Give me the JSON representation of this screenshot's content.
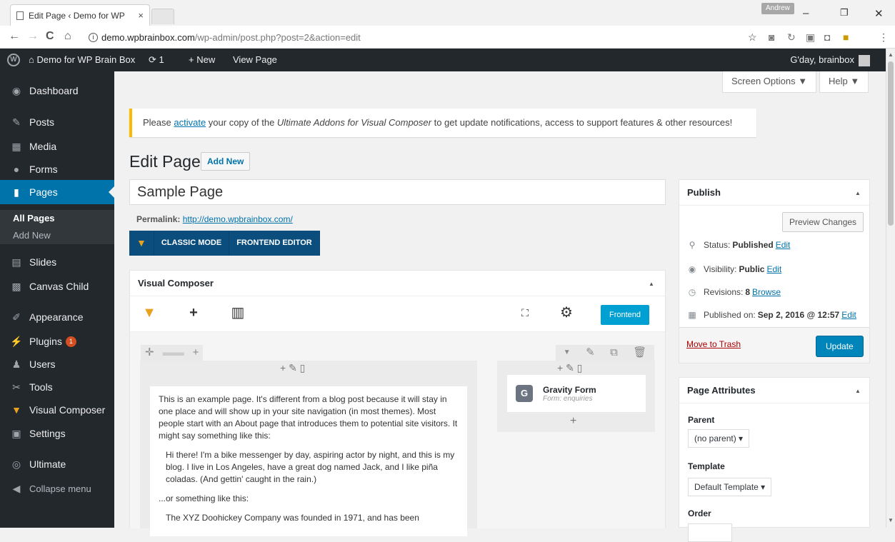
{
  "browser": {
    "tab_title": "Edit Page ‹ Demo for WP",
    "tab_close": "×",
    "profile": "Andrew",
    "win_min": "–",
    "win_max": "❐",
    "win_close": "✕",
    "back": "←",
    "forward": "→",
    "reload": "C",
    "home": "⌂",
    "url_host": "demo.wpbrainbox.com",
    "url_path": "/wp-admin/post.php?post=2&action=edit",
    "bookmark": "☆",
    "menu": "⋮"
  },
  "adminbar": {
    "site_name": "Demo for WP Brain Box",
    "updates_count": "1",
    "new_label": "New",
    "view_page": "View Page",
    "greeting": "G'day, brainbox"
  },
  "sidebar": {
    "items": [
      {
        "label": "Dashboard",
        "icon": "dashboard-icon"
      },
      {
        "label": "Posts",
        "icon": "pin-icon"
      },
      {
        "label": "Media",
        "icon": "media-icon"
      },
      {
        "label": "Forms",
        "icon": "forms-icon"
      },
      {
        "label": "Pages",
        "icon": "pages-icon"
      },
      {
        "label": "Slides",
        "icon": "slides-icon"
      },
      {
        "label": "Canvas Child",
        "icon": "canvas-icon"
      },
      {
        "label": "Appearance",
        "icon": "brush-icon"
      },
      {
        "label": "Plugins",
        "icon": "plugin-icon",
        "badge": "1"
      },
      {
        "label": "Users",
        "icon": "users-icon"
      },
      {
        "label": "Tools",
        "icon": "wrench-icon"
      },
      {
        "label": "Visual Composer",
        "icon": "vc-icon"
      },
      {
        "label": "Settings",
        "icon": "settings-icon"
      },
      {
        "label": "Ultimate",
        "icon": "ultimate-icon"
      },
      {
        "label": "Collapse menu",
        "icon": "collapse-icon"
      }
    ],
    "submenu": [
      "All Pages",
      "Add New"
    ]
  },
  "screen_options": "Screen Options ▼",
  "help": "Help ▼",
  "notice": {
    "before": "Please ",
    "link": "activate",
    "middle": " your copy of the ",
    "product": "Ultimate Addons for Visual Composer",
    "after": " to get update notifications, access to support features & other resources!"
  },
  "page": {
    "heading": "Edit Page",
    "add_new": "Add New",
    "title_value": "Sample Page",
    "permalink_label": "Permalink:",
    "permalink_url": "http://demo.wpbrainbox.com/",
    "classic_mode": "CLASSIC MODE",
    "frontend_editor": "FRONTEND EDITOR"
  },
  "vc": {
    "title": "Visual Composer",
    "frontend_button": "Frontend",
    "text_p1": "This is an example page. It's different from a blog post because it will stay in one place and will show up in your site navigation (in most themes). Most people start with an About page that introduces them to potential site visitors. It might say something like this:",
    "text_quote1": "Hi there! I'm a bike messenger by day, aspiring actor by night, and this is my blog. I live in Los Angeles, have a great dog named Jack, and I like piña coladas. (And gettin' caught in the rain.)",
    "text_p2": "...or something like this:",
    "text_quote2": "The XYZ Doohickey Company was founded in 1971, and has been",
    "gravity_name": "Gravity Form",
    "gravity_sub": "Form: enquiries"
  },
  "publish": {
    "title": "Publish",
    "preview": "Preview Changes",
    "status_label": "Status:",
    "status_value": "Published",
    "visibility_label": "Visibility:",
    "visibility_value": "Public",
    "revisions_label": "Revisions:",
    "revisions_value": "8",
    "revisions_link": "Browse",
    "published_label": "Published on:",
    "published_value": "Sep 2, 2016 @ 12:57",
    "edit": "Edit",
    "trash": "Move to Trash",
    "update": "Update"
  },
  "attributes": {
    "title": "Page Attributes",
    "parent_label": "Parent",
    "parent_value": "(no parent) ▾",
    "template_label": "Template",
    "template_value": "Default Template ▾",
    "order_label": "Order"
  },
  "colors": {
    "accent": "#0073aa",
    "admin_dark": "#23282d",
    "notice": "#ffb900",
    "update": "#0085ba",
    "frontend": "#00a0d2"
  }
}
